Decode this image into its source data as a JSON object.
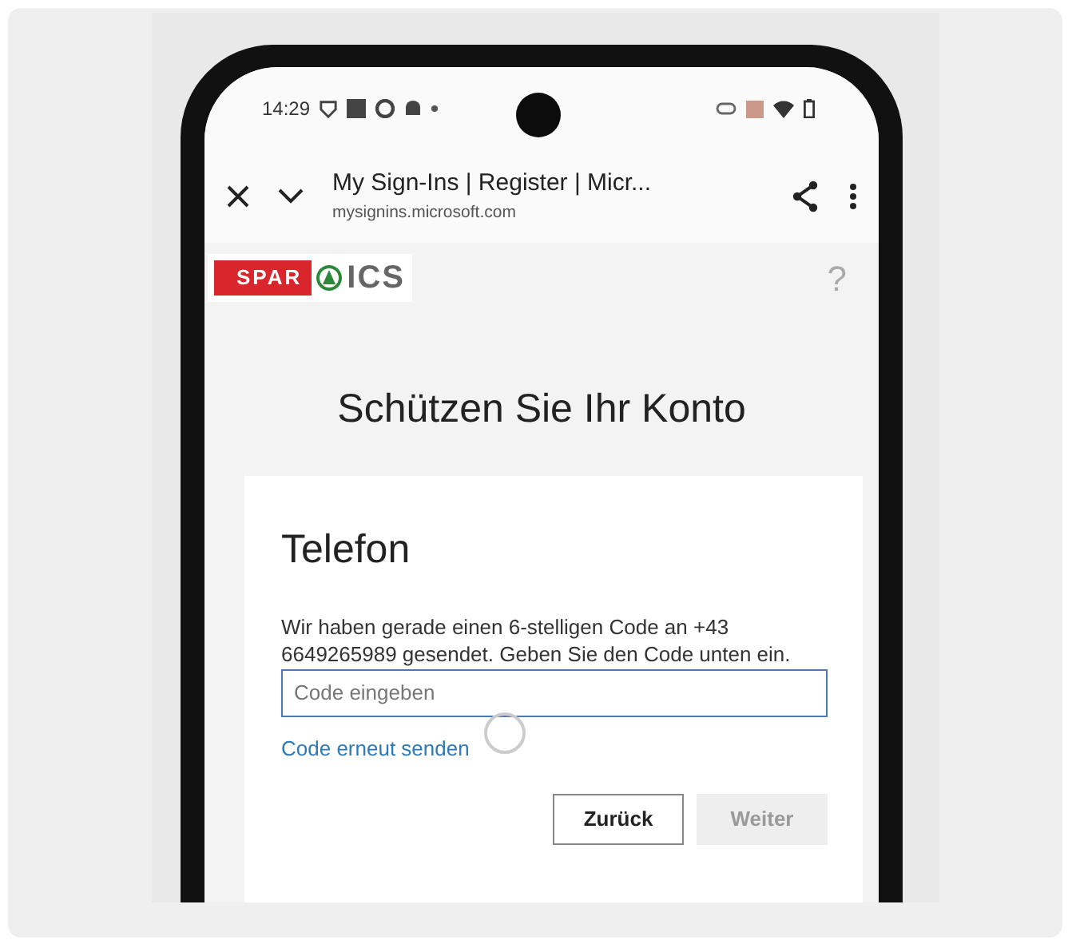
{
  "status_bar": {
    "time": "14:29"
  },
  "browser_bar": {
    "page_title": "My Sign-Ins | Register | Micr...",
    "url": "mysignins.microsoft.com"
  },
  "header": {
    "logo_left": "SPAR",
    "logo_right": "ICS",
    "help": "?"
  },
  "title": "Schützen Sie Ihr Konto",
  "card": {
    "heading": "Telefon",
    "message": "Wir haben gerade einen 6-stelligen Code an +43 6649265989 gesendet. Geben Sie den Code unten ein.",
    "code_field": {
      "placeholder": "Code eingeben"
    },
    "resend_link": "Code erneut senden",
    "buttons": [
      {
        "label": "Zurück",
        "disabled": false
      },
      {
        "label": "Weiter",
        "disabled": true
      }
    ]
  }
}
